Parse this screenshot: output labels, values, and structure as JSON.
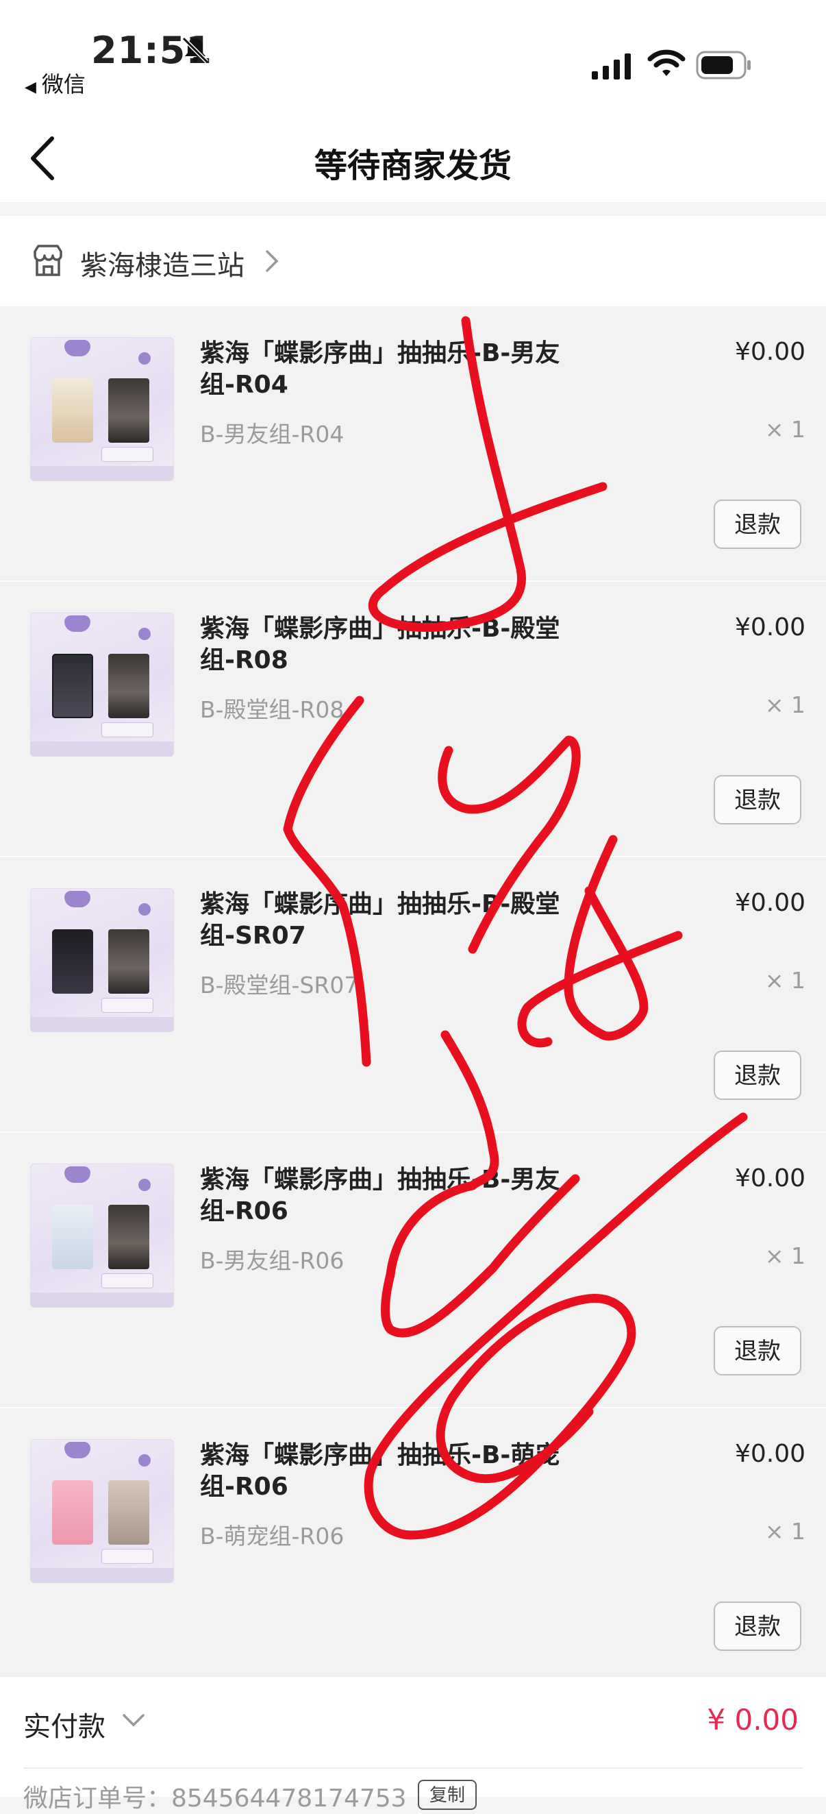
{
  "status_bar": {
    "time": "21:51",
    "back_app_label": "微信"
  },
  "nav": {
    "title": "等待商家发货"
  },
  "shop": {
    "name": "紫海棣造三站"
  },
  "items": [
    {
      "title": "紫海「蝶影序曲」抽抽乐-B-男友组-R04",
      "variant": "B-男友组-R04",
      "price": "¥0.00",
      "qty": "× 1",
      "refund_label": "退款"
    },
    {
      "title": "紫海「蝶影序曲」抽抽乐-B-殿堂组-R08",
      "variant": "B-殿堂组-R08",
      "price": "¥0.00",
      "qty": "× 1",
      "refund_label": "退款"
    },
    {
      "title": "紫海「蝶影序曲」抽抽乐-B-殿堂组-SR07",
      "variant": "B-殿堂组-SR07",
      "price": "¥0.00",
      "qty": "× 1",
      "refund_label": "退款"
    },
    {
      "title": "紫海「蝶影序曲」抽抽乐-B-男友组-R06",
      "variant": "B-男友组-R06",
      "price": "¥0.00",
      "qty": "× 1",
      "refund_label": "退款"
    },
    {
      "title": "紫海「蝶影序曲」抽抽乐-B-萌宠组-R06",
      "variant": "B-萌宠组-R06",
      "price": "¥0.00",
      "qty": "× 1",
      "refund_label": "退款"
    }
  ],
  "footer": {
    "paid_label": "实付款",
    "paid_amount": "¥ 0.00",
    "order_number": "微店订单号：854564478174753",
    "copy_label": "复制"
  },
  "colors": {
    "accent_red": "#e8284f",
    "ink_red": "#e8101e"
  }
}
